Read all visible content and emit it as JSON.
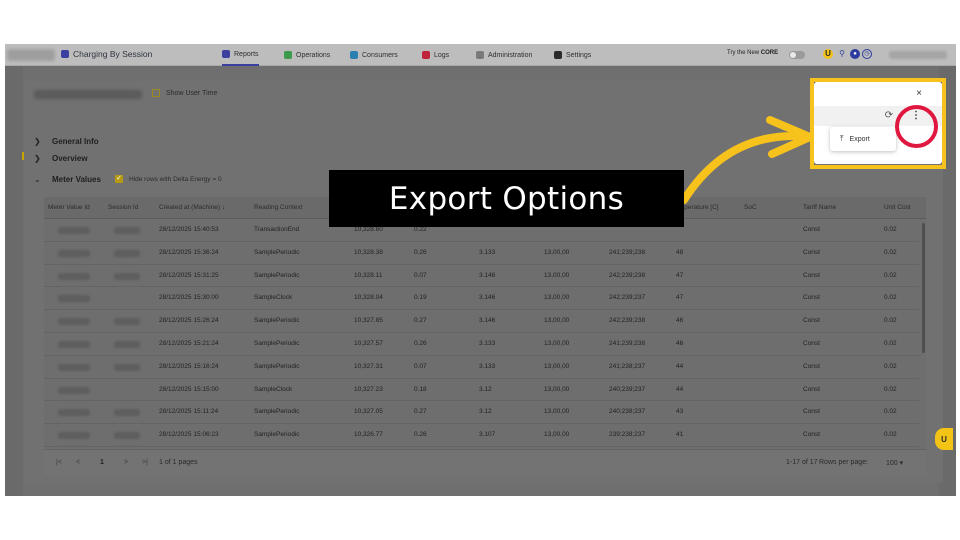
{
  "app": {
    "title": "Charging By Session",
    "nav": [
      {
        "label": "Reports",
        "icon": "reports-icon",
        "color": "#3b3f9e",
        "active": true
      },
      {
        "label": "Operations",
        "icon": "operations-icon",
        "color": "#3c9a4a",
        "active": false
      },
      {
        "label": "Consumers",
        "icon": "consumers-icon",
        "color": "#2a7fb0",
        "active": false
      },
      {
        "label": "Logs",
        "icon": "logs-icon",
        "color": "#c0243a",
        "active": false
      },
      {
        "label": "Administration",
        "icon": "administration-icon",
        "color": "#7a7a7a",
        "active": false
      },
      {
        "label": "Settings",
        "icon": "settings-icon",
        "color": "#2b2b2b",
        "active": false
      }
    ],
    "try_new_prefix": "Try the New ",
    "try_new_brand": "CORE"
  },
  "modal": {
    "show_user_time_label": "Show User Time",
    "sections": {
      "general_info": "General Info",
      "overview": "Overview",
      "meter_values": "Meter Values"
    },
    "hide_rows_label": "Hide rows with Delta Energy = 0"
  },
  "table": {
    "columns": [
      "Meter Value Id",
      "Session Id",
      "Created at (Machine) ↓",
      "Reading Context",
      "Temperature [C]",
      "SoC",
      "Tariff Name",
      "Unit Cost"
    ],
    "rows": [
      {
        "created": "28/12/2025 15:40:53",
        "context": "TransactionEnd",
        "energy": "10,328.60",
        "delta": "0.22",
        "c1": "",
        "c2": "",
        "c3": "",
        "temp": "",
        "tariff": "Const",
        "cost": "0.02"
      },
      {
        "created": "28/12/2025 15:36:24",
        "context": "SamplePeriodic",
        "energy": "10,328.38",
        "delta": "0.26",
        "c1": "3.133",
        "c2": "13,00,00",
        "c3": "241;239;238",
        "temp": "48",
        "tariff": "Const",
        "cost": "0.02"
      },
      {
        "created": "28/12/2025 15:31:25",
        "context": "SamplePeriodic",
        "energy": "10,328.11",
        "delta": "0.07",
        "c1": "3.146",
        "c2": "13,00,00",
        "c3": "242;239;238",
        "temp": "47",
        "tariff": "Const",
        "cost": "0.02"
      },
      {
        "created": "28/12/2025 15:30:00",
        "context": "SampleClock",
        "energy": "10,328.04",
        "delta": "0.19",
        "c1": "3.146",
        "c2": "13,00,00",
        "c3": "242;239;237",
        "temp": "47",
        "tariff": "Const",
        "cost": "0.02"
      },
      {
        "created": "28/12/2025 15:26:24",
        "context": "SamplePeriodic",
        "energy": "10,327.85",
        "delta": "0.27",
        "c1": "3.146",
        "c2": "13,00,00",
        "c3": "242;239;238",
        "temp": "46",
        "tariff": "Const",
        "cost": "0.02"
      },
      {
        "created": "28/12/2025 15:21:24",
        "context": "SamplePeriodic",
        "energy": "10,327.57",
        "delta": "0.26",
        "c1": "3.133",
        "c2": "13,00,00",
        "c3": "241;239;238",
        "temp": "46",
        "tariff": "Const",
        "cost": "0.02"
      },
      {
        "created": "28/12/2025 15:16:24",
        "context": "SamplePeriodic",
        "energy": "10,327.31",
        "delta": "0.07",
        "c1": "3.133",
        "c2": "13,00,00",
        "c3": "241;238;237",
        "temp": "44",
        "tariff": "Const",
        "cost": "0.02"
      },
      {
        "created": "28/12/2025 15:15:00",
        "context": "SampleClock",
        "energy": "10,327.23",
        "delta": "0.18",
        "c1": "3.12",
        "c2": "13,00,00",
        "c3": "240;239;237",
        "temp": "44",
        "tariff": "Const",
        "cost": "0.02"
      },
      {
        "created": "28/12/2025 15:11:24",
        "context": "SamplePeriodic",
        "energy": "10,327.05",
        "delta": "0.27",
        "c1": "3.12",
        "c2": "13,00,00",
        "c3": "240;238;237",
        "temp": "43",
        "tariff": "Const",
        "cost": "0.02"
      },
      {
        "created": "28/12/2025 15:06:23",
        "context": "SamplePeriodic",
        "energy": "10,326.77",
        "delta": "0.26",
        "c1": "3.107",
        "c2": "13,00,00",
        "c3": "239;238;237",
        "temp": "41",
        "tariff": "Const",
        "cost": "0.02"
      }
    ]
  },
  "pagination": {
    "first": "|<",
    "prev": "<",
    "current": "1",
    "next": ">",
    "last": ">|",
    "page_of": "1 of 1 pages",
    "range": "1-17 of 17",
    "rows_per_page_label": "Rows per page:",
    "rows_per_page_value": "100"
  },
  "popover": {
    "close": "×",
    "export_label": "Export"
  },
  "caption": "Export Options",
  "colors": {
    "highlight_box": "#f6c21b",
    "highlight_circle": "#e0173e",
    "arrow": "#f6c21b",
    "caption_bg": "#000000"
  }
}
